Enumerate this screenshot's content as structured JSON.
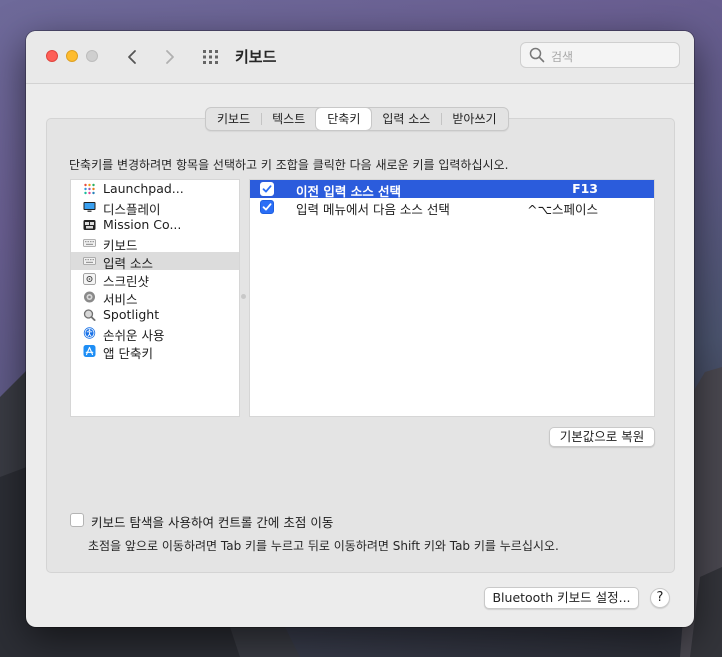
{
  "window": {
    "title": "키보드"
  },
  "search": {
    "placeholder": "검색"
  },
  "tabs": [
    "키보드",
    "텍스트",
    "단축키",
    "입력 소스",
    "받아쓰기"
  ],
  "active_tab": "단축키",
  "instruction": "단축키를 변경하려면 항목을 선택하고 키 조합을 클릭한 다음 새로운 키를 입력하십시오.",
  "categories": [
    {
      "label": "Launchpad...",
      "icon": "launchpad-icon"
    },
    {
      "label": "디스플레이",
      "icon": "display-icon"
    },
    {
      "label": "Mission Co...",
      "icon": "mission-control-icon"
    },
    {
      "label": "키보드",
      "icon": "keyboard-icon"
    },
    {
      "label": "입력 소스",
      "icon": "input-source-icon"
    },
    {
      "label": "스크린샷",
      "icon": "screenshot-icon"
    },
    {
      "label": "서비스",
      "icon": "gear-icon"
    },
    {
      "label": "Spotlight",
      "icon": "spotlight-icon"
    },
    {
      "label": "손쉬운 사용",
      "icon": "accessibility-icon"
    },
    {
      "label": "앱 단축키",
      "icon": "app-store-icon"
    }
  ],
  "selected_category": "입력 소스",
  "shortcuts": [
    {
      "label": "이전 입력 소스 선택",
      "key": "F13",
      "checked": true,
      "selected": true
    },
    {
      "label": "입력 메뉴에서 다음 소스 선택",
      "key": "^⌥스페이스",
      "checked": true,
      "selected": false
    }
  ],
  "restore_button": "기본값으로 복원",
  "keyboard_nav": {
    "label": "키보드 탐색을 사용하여 컨트롤 간에 초점 이동",
    "checked": false,
    "hint": "초점을 앞으로 이동하려면 Tab 키를 누르고 뒤로 이동하려면 Shift 키와 Tab 키를 누르십시오."
  },
  "bluetooth_button": "Bluetooth 키보드 설정...",
  "help_button": "?",
  "colors": {
    "selection": "#2b5cdc",
    "checkbox": "#2a6ef6"
  }
}
